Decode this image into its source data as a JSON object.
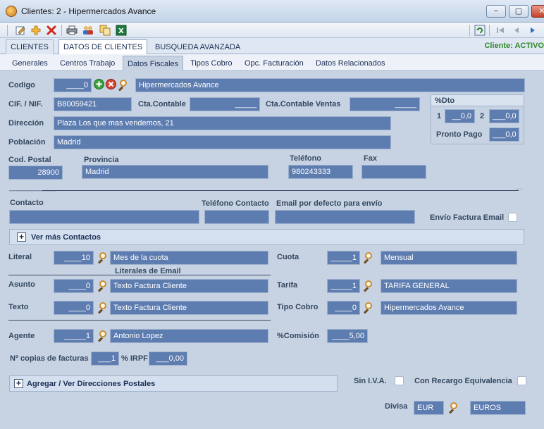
{
  "window": {
    "title": "Clientes: 2 - Hipermercados Avance",
    "minimize": "−",
    "maximize": "▢",
    "close": "✕"
  },
  "main_tabs": [
    "CLIENTES",
    "DATOS DE CLIENTES",
    "BUSQUEDA AVANZADA"
  ],
  "client_status": "Cliente: ACTIVO",
  "sub_tabs": [
    "Generales",
    "Centros Trabajo",
    "Datos Fiscales",
    "Tipos Cobro",
    "Opc. Facturación",
    "Datos Relacionados"
  ],
  "labels": {
    "codigo": "Codigo",
    "cif": "CIF. / NIF.",
    "cta_contable": "Cta.Contable",
    "cta_contable_ventas": "Cta.Contable Ventas",
    "direccion": "Dirección",
    "poblacion": "Población",
    "cod_postal": "Cod. Postal",
    "provincia": "Provincia",
    "telefono": "Teléfono",
    "fax": "Fax",
    "contacto": "Contacto",
    "telefono_contacto": "Teléfono Contacto",
    "email_envio": "Email por defecto para envío",
    "envio_factura_email": "Envío Factura Email",
    "ver_mas_contactos": "Ver más Contactos",
    "literal": "Literal",
    "literales_email": "Literales de Email",
    "asunto": "Asunto",
    "texto": "Texto",
    "agente": "Agente",
    "cuota": "Cuota",
    "tarifa": "Tarifa",
    "tipo_cobro": "Tipo Cobro",
    "comision": "%Comisión",
    "copias_facturas": "Nº copias de facturas",
    "irpf": "% IRPF",
    "direcciones_postales": "Agregar / Ver  Direcciones Postales",
    "sin_iva": "Sin I.V.A.",
    "recargo_equivalencia": "Con Recargo Equivalencia",
    "divisa": "Divisa",
    "dto_title": "%Dto",
    "dto_1": "1",
    "dto_2": "2",
    "pronto_pago": "Pronto Pago"
  },
  "fields": {
    "codigo": "____0",
    "nombre": "Hipermercados Avance",
    "cif": "B80059421",
    "cta_contable": "_____",
    "cta_contable_ventas": "_____",
    "direccion": "Plaza Los que mas vendemos, 21",
    "poblacion": "Madrid",
    "cod_postal": "28900",
    "provincia": "Madrid",
    "telefono": "980243333",
    "fax": "",
    "contacto": "",
    "telefono_contacto": "",
    "email_envio": "",
    "literal_code": "____10",
    "literal_desc": "Mes de la cuota",
    "asunto_code": "____0",
    "asunto_desc": "Texto Factura Cliente",
    "texto_code": "____0",
    "texto_desc": "Texto Factura Cliente",
    "agente_code": "_____1",
    "agente_desc": "Antonio Lopez",
    "cuota_code": "_____1",
    "cuota_desc": "Mensual",
    "tarifa_code": "_____1",
    "tarifa_desc": "TARIFA GENERAL",
    "tipo_cobro_code": "____0",
    "tipo_cobro_desc": "Hipermercados Avance",
    "comision": "____5,00",
    "copias": "___1",
    "irpf": "___0,00",
    "dto_1": "__0,0",
    "dto_2": "___0,0",
    "pronto_pago": "___0,0",
    "divisa_code": "EUR",
    "divisa_desc": "EUROS"
  },
  "separator_dashes": "_____________",
  "separator_dots": "...",
  "checkboxes": {
    "envio_factura_email": false,
    "sin_iva": false,
    "recargo_equivalencia": false
  },
  "icons": [
    "edit-icon",
    "add-icon",
    "delete-icon",
    "print-icon",
    "users-icon",
    "copy-icon",
    "excel-icon",
    "refresh-icon",
    "first-icon",
    "prev-icon",
    "next-icon",
    "search-icon"
  ],
  "colors": {
    "field_bg": "#5d7cb0",
    "panel_bg": "#c7d3e3",
    "status_green": "#2e8a2e",
    "label": "#33475f"
  }
}
